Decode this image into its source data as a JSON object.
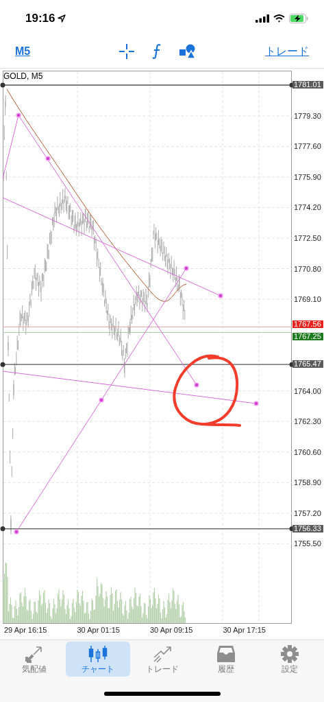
{
  "status_bar": {
    "time": "19:16"
  },
  "toolbar": {
    "timeframe": "M5",
    "trade_link": "トレード"
  },
  "chart": {
    "symbol": "GOLD, M5",
    "price_ticks": [
      "1779.30",
      "1777.60",
      "1775.90",
      "1774.20",
      "1772.50",
      "1770.80",
      "1769.10",
      "1764.00",
      "1762.30",
      "1760.60",
      "1758.90",
      "1757.20",
      "1755.50"
    ],
    "level_tags": [
      {
        "text": "1781.01",
        "kind": "line"
      },
      {
        "text": "1767.56",
        "kind": "bid"
      },
      {
        "text": "1767.25",
        "kind": "ask"
      },
      {
        "text": "1765.47",
        "kind": "line"
      },
      {
        "text": "1756.33",
        "kind": "line"
      }
    ],
    "time_ticks": [
      "29 Apr 16:15",
      "30 Apr 01:15",
      "30 Apr 09:15",
      "30 Apr 17:15"
    ]
  },
  "tabs": [
    {
      "label": "気配値",
      "kind": "quotes",
      "selected": false
    },
    {
      "label": "チャート",
      "kind": "chart",
      "selected": true
    },
    {
      "label": "トレード",
      "kind": "trade",
      "selected": false
    },
    {
      "label": "履歴",
      "kind": "history",
      "selected": false
    },
    {
      "label": "設定",
      "kind": "settings",
      "selected": false
    }
  ]
}
